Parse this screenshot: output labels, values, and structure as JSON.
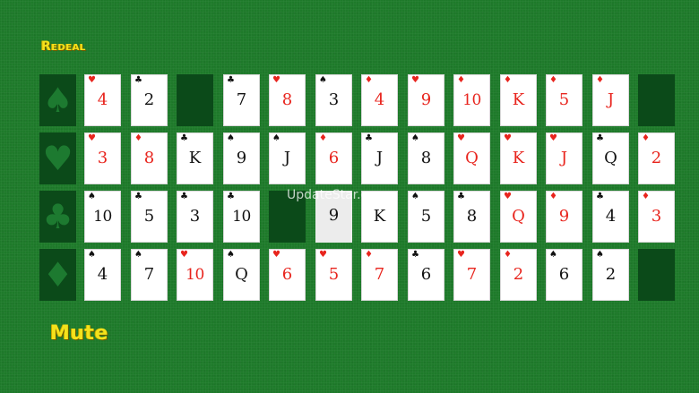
{
  "controls": {
    "redeal_label": "Redeal",
    "mute_label": "Mute"
  },
  "suit_slots": [
    {
      "suit": "spade",
      "glyph": "♠"
    },
    {
      "suit": "heart",
      "glyph": "♥"
    },
    {
      "suit": "club",
      "glyph": "♣"
    },
    {
      "suit": "diamond",
      "glyph": "♦"
    }
  ],
  "watermark": "UpdateStar.com",
  "grid": [
    [
      {
        "rank": "4",
        "suit": "♥",
        "color": "red"
      },
      {
        "rank": "2",
        "suit": "♣",
        "color": "black"
      },
      {
        "type": "gap"
      },
      {
        "rank": "7",
        "suit": "♣",
        "color": "black"
      },
      {
        "rank": "8",
        "suit": "♥",
        "color": "red"
      },
      {
        "rank": "3",
        "suit": "♠",
        "color": "black"
      },
      {
        "rank": "4",
        "suit": "♦",
        "color": "red"
      },
      {
        "rank": "9",
        "suit": "♥",
        "color": "red"
      },
      {
        "rank": "10",
        "suit": "♦",
        "color": "red"
      },
      {
        "rank": "K",
        "suit": "♦",
        "color": "red"
      },
      {
        "rank": "5",
        "suit": "♦",
        "color": "red"
      },
      {
        "rank": "J",
        "suit": "♦",
        "color": "red"
      },
      {
        "type": "gap"
      }
    ],
    [
      {
        "rank": "3",
        "suit": "♥",
        "color": "red"
      },
      {
        "rank": "8",
        "suit": "♦",
        "color": "red"
      },
      {
        "rank": "K",
        "suit": "♣",
        "color": "black"
      },
      {
        "rank": "9",
        "suit": "♠",
        "color": "black"
      },
      {
        "rank": "J",
        "suit": "♠",
        "color": "black"
      },
      {
        "rank": "6",
        "suit": "♦",
        "color": "red"
      },
      {
        "rank": "J",
        "suit": "♣",
        "color": "black"
      },
      {
        "rank": "8",
        "suit": "♠",
        "color": "black"
      },
      {
        "rank": "Q",
        "suit": "♥",
        "color": "red"
      },
      {
        "rank": "K",
        "suit": "♥",
        "color": "red"
      },
      {
        "rank": "J",
        "suit": "♥",
        "color": "red"
      },
      {
        "rank": "Q",
        "suit": "♣",
        "color": "black"
      },
      {
        "rank": "2",
        "suit": "♦",
        "color": "red"
      }
    ],
    [
      {
        "rank": "10",
        "suit": "♠",
        "color": "black"
      },
      {
        "rank": "5",
        "suit": "♣",
        "color": "black"
      },
      {
        "rank": "3",
        "suit": "♣",
        "color": "black"
      },
      {
        "rank": "10",
        "suit": "♣",
        "color": "black"
      },
      {
        "type": "gap"
      },
      {
        "type": "ghost",
        "rank": "9"
      },
      {
        "rank": "K",
        "suit": "",
        "color": "black"
      },
      {
        "rank": "5",
        "suit": "♠",
        "color": "black"
      },
      {
        "rank": "8",
        "suit": "♣",
        "color": "black"
      },
      {
        "rank": "Q",
        "suit": "♥",
        "color": "red"
      },
      {
        "rank": "9",
        "suit": "♦",
        "color": "red"
      },
      {
        "rank": "4",
        "suit": "♣",
        "color": "black"
      },
      {
        "rank": "3",
        "suit": "♦",
        "color": "red"
      }
    ],
    [
      {
        "rank": "4",
        "suit": "♠",
        "color": "black"
      },
      {
        "rank": "7",
        "suit": "♠",
        "color": "black"
      },
      {
        "rank": "10",
        "suit": "♥",
        "color": "red"
      },
      {
        "rank": "Q",
        "suit": "♠",
        "color": "black"
      },
      {
        "rank": "6",
        "suit": "♥",
        "color": "red"
      },
      {
        "rank": "5",
        "suit": "♥",
        "color": "red"
      },
      {
        "rank": "7",
        "suit": "♦",
        "color": "red"
      },
      {
        "rank": "6",
        "suit": "♣",
        "color": "black"
      },
      {
        "rank": "7",
        "suit": "♥",
        "color": "red"
      },
      {
        "rank": "2",
        "suit": "♦",
        "color": "red"
      },
      {
        "rank": "6",
        "suit": "♠",
        "color": "black"
      },
      {
        "rank": "2",
        "suit": "♠",
        "color": "black"
      },
      {
        "type": "gap"
      }
    ]
  ]
}
